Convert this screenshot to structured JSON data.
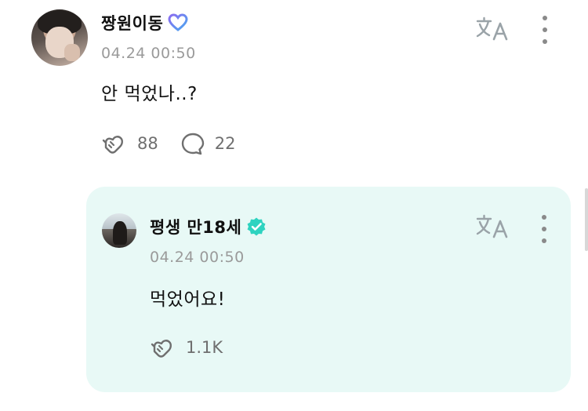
{
  "post": {
    "author": "짱원이동",
    "badge_icon": "heart-badge-icon",
    "date": "04.24 00:50",
    "text": "안 먹었나..?",
    "like_count": "88",
    "comment_count": "22"
  },
  "reply": {
    "author": "평생 만18세",
    "badge_icon": "verified-icon",
    "date": "04.24 00:50",
    "text": "먹었어요!",
    "like_count": "1.1K"
  },
  "icons": {
    "translate": "translate-icon",
    "more": "more-vertical-icon",
    "like": "heart-hands-icon",
    "comment": "comment-bubble-icon"
  },
  "colors": {
    "reply_bg": "#e8f9f6",
    "verified": "#2ed3c0",
    "muted": "#9a9a9a"
  }
}
